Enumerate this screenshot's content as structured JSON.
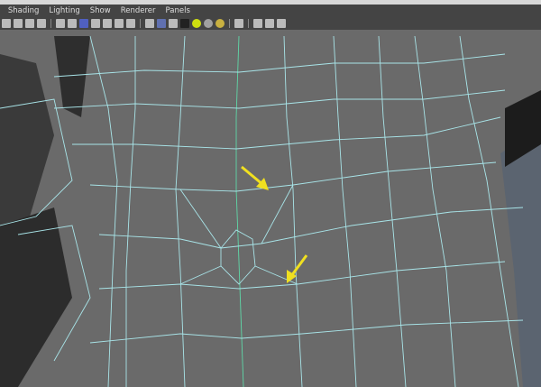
{
  "menu": {
    "items": [
      "Shading",
      "Lighting",
      "Show",
      "Renderer",
      "Panels"
    ]
  },
  "toolbar": {
    "icons": [
      "camera-attributes-icon",
      "bookmark-icon",
      "image-plane-icon",
      "grid-icon",
      "|",
      "isolate-icon",
      "wireframe-grid-icon",
      "smooth-shade-icon",
      "flat-shade-icon",
      "xray-icon",
      "texture-icon",
      "text-icon",
      "|",
      "wireframe-cube-icon",
      "shaded-cube-icon",
      "wireframe-on-shaded-icon",
      "checker-icon",
      "default-light-icon",
      "all-lights-icon",
      "selected-light-icon",
      "|",
      "select-icon",
      "|",
      "backface-icon",
      "two-sided-icon",
      "share-icon"
    ]
  },
  "colors": {
    "wire": "#a8e4e8",
    "wire_center": "#5fd8a8",
    "arrow": "#f0e020",
    "mesh": "#6a6a6a"
  }
}
